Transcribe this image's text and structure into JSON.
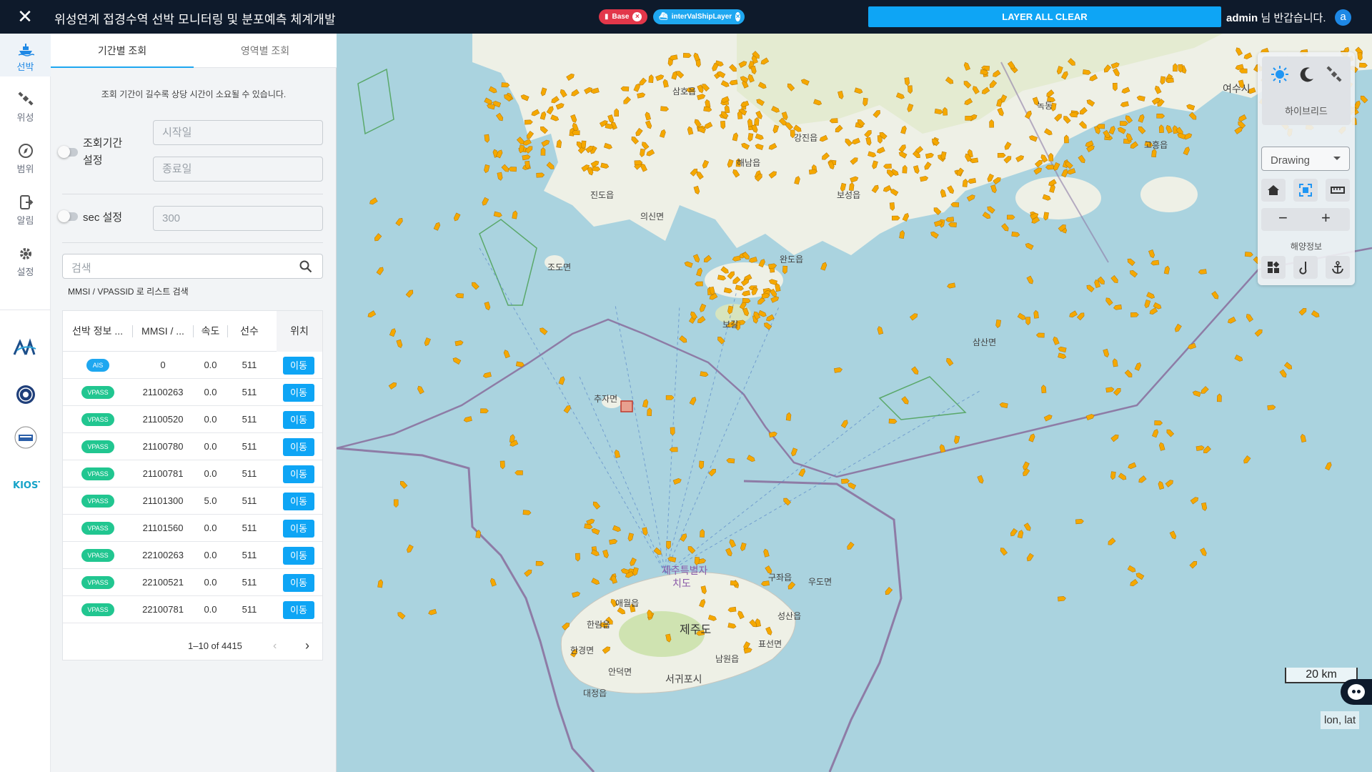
{
  "header": {
    "title": "위성연계 접경수역 선박 모니터링 및 분포예측 체계개발",
    "chips": [
      {
        "label": "Base"
      },
      {
        "label": "interValShipLayer"
      }
    ],
    "clear_button": "LAYER ALL CLEAR",
    "user_name": "admin",
    "welcome_suffix": "님 반갑습니다.",
    "avatar_letter": "a"
  },
  "leftnav": {
    "items": [
      {
        "label": "선박",
        "icon": "ship-icon"
      },
      {
        "label": "위성",
        "icon": "satellite-icon"
      },
      {
        "label": "범위",
        "icon": "compass-icon"
      },
      {
        "label": "알림",
        "icon": "alert-icon"
      },
      {
        "label": "설정",
        "icon": "gear-icon"
      }
    ],
    "logos": [
      "logo-var",
      "logo-emblem-1",
      "logo-emblem-2",
      "logo-kiost"
    ]
  },
  "panel": {
    "tabs": [
      "기간별 조회",
      "영역별 조회"
    ],
    "hint": "조회 기간이 길수록 상당 시간이 소요될 수 있습니다.",
    "period_label_1": "조회기간",
    "period_label_2": "설정",
    "start_placeholder": "시작일",
    "end_placeholder": "종료일",
    "sec_label": "sec 설정",
    "sec_placeholder": "300",
    "search_placeholder": "검색",
    "search_hint": "MMSI / VPASSID 로 리스트 검색",
    "columns": [
      "선박 정보 ...",
      "MMSI / ...",
      "속도",
      "선수",
      "위치"
    ],
    "rows": [
      {
        "type": "AIS",
        "id": "0",
        "speed": "0.0",
        "heading": "511",
        "action": "이동"
      },
      {
        "type": "VPASS",
        "id": "21100263",
        "speed": "0.0",
        "heading": "511",
        "action": "이동"
      },
      {
        "type": "VPASS",
        "id": "21100520",
        "speed": "0.0",
        "heading": "511",
        "action": "이동"
      },
      {
        "type": "VPASS",
        "id": "21100780",
        "speed": "0.0",
        "heading": "511",
        "action": "이동"
      },
      {
        "type": "VPASS",
        "id": "21100781",
        "speed": "0.0",
        "heading": "511",
        "action": "이동"
      },
      {
        "type": "VPASS",
        "id": "21101300",
        "speed": "5.0",
        "heading": "511",
        "action": "이동"
      },
      {
        "type": "VPASS",
        "id": "21101560",
        "speed": "0.0",
        "heading": "511",
        "action": "이동"
      },
      {
        "type": "VPASS",
        "id": "22100263",
        "speed": "0.0",
        "heading": "511",
        "action": "이동"
      },
      {
        "type": "VPASS",
        "id": "22100521",
        "speed": "0.0",
        "heading": "511",
        "action": "이동"
      },
      {
        "type": "VPASS",
        "id": "22100781",
        "speed": "0.0",
        "heading": "511",
        "action": "이동"
      }
    ],
    "pagination": "1–10 of 4415"
  },
  "map": {
    "mode_label": "하이브리드",
    "drawing_select": "Drawing",
    "ocean_info_label": "해양정보",
    "scale": "20 km",
    "coord_readout": "lon, lat",
    "place_labels": {
      "jeju_city_1": "제주특별자",
      "jeju_city_2": "치도",
      "jeju": "제주도",
      "seogwipo": "서귀포시",
      "haenam": "해남읍",
      "wando": "완도읍",
      "jindo": "진도읍",
      "yeosu": "여수시",
      "chuja": "추자면",
      "goheung": "고흥읍",
      "bogil": "보길",
      "sangsan": "삼산면",
      "gujwa": "구좌읍",
      "udo": "우도면",
      "seongsan": "성산읍",
      "pyoseon": "표선면",
      "namwon": "남원읍",
      "andeok": "안덕면",
      "daejeong": "대정읍",
      "hangyeong": "한경면",
      "hallim": "한림읍",
      "aewol": "애월읍",
      "jodo": "조도면",
      "uisin": "의신면",
      "mokpo_area": "삼호읍",
      "gangjin": "강진읍",
      "boseong": "보성읍",
      "noryang": "녹동"
    },
    "colors": {
      "sea": "#aad3df",
      "land": "#f2efe9",
      "ship": "#f5a800",
      "boundary": "#8e7ca6",
      "zone": "#5aa86a"
    }
  }
}
